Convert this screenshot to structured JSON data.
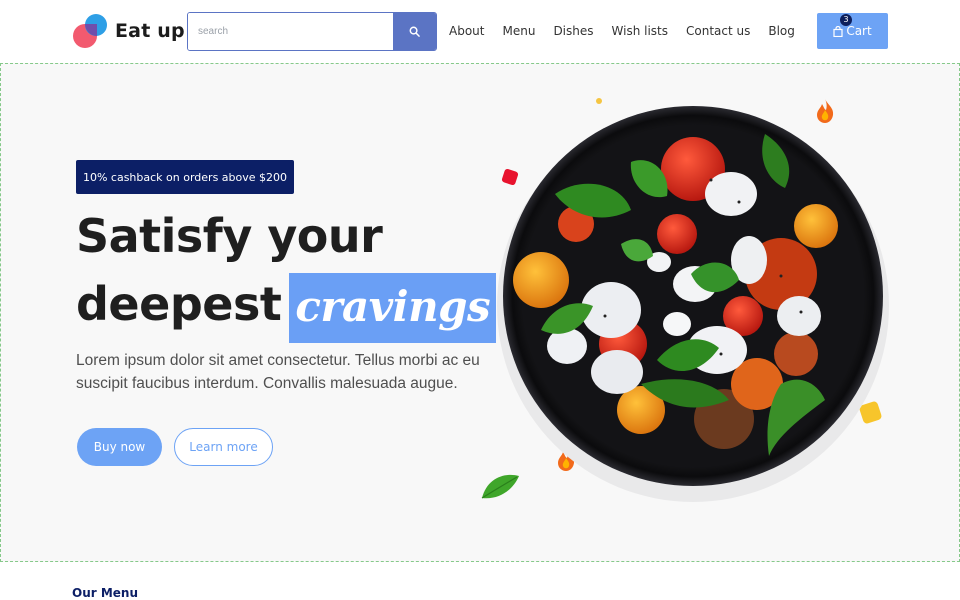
{
  "brand": {
    "name": "Eat up",
    "colors": {
      "blue": "#2e9fe6",
      "pink": "#f25a6f"
    }
  },
  "search": {
    "placeholder": "search",
    "value": "",
    "icon": "search-icon"
  },
  "nav": {
    "items": [
      "About",
      "Menu",
      "Dishes",
      "Wish lists",
      "Contact us",
      "Blog"
    ]
  },
  "cart": {
    "label": "Cart",
    "count": "3",
    "icon": "shopping-bag-icon"
  },
  "hero": {
    "promo": "10% cashback on orders above $200",
    "headline_line1": "Satisfy your",
    "headline_line2": "deepest",
    "headline_highlight": "cravings",
    "description": "Lorem ipsum dolor sit amet consectetur. Tellus morbi ac eu suscipit faucibus interdum. Convallis malesuada augue.",
    "buy_label": "Buy now",
    "learn_label": "Learn more",
    "image": "caprese-salad-plate"
  },
  "menu_section": {
    "title": "Our Menu"
  },
  "colors": {
    "accent": "#6da3f5",
    "navy": "#0c1f66",
    "search_button": "#5b74c4",
    "hero_bg": "#f8f8f8"
  }
}
